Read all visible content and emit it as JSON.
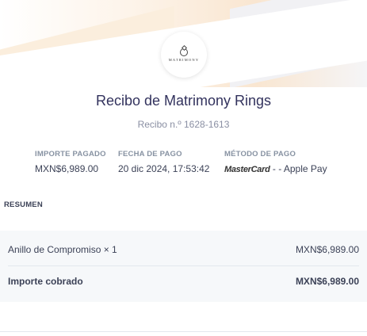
{
  "brand": {
    "logo_text": "MATRIMONY"
  },
  "header": {
    "title": "Recibo de Matrimony Rings",
    "receipt_number": "Recibo n.º 1628-1613"
  },
  "details": {
    "amount_label": "IMPORTE PAGADO",
    "amount_value": "MXN$6,989.00",
    "date_label": "FECHA DE PAGO",
    "date_value": "20 dic 2024, 17:53:42",
    "method_label": "MÉTODO DE PAGO",
    "method_card_brand": "MasterCard",
    "method_value": " - - Apple Pay"
  },
  "summary": {
    "label": "RESUMEN",
    "item_name": "Anillo de Compromiso × 1",
    "item_amount": "MXN$6,989.00",
    "total_label": "Importe cobrado",
    "total_amount": "MXN$6,989.00"
  },
  "colors": {
    "title": "#32325d",
    "muted": "#8792a2",
    "summary_bg": "#f6f8fa"
  }
}
